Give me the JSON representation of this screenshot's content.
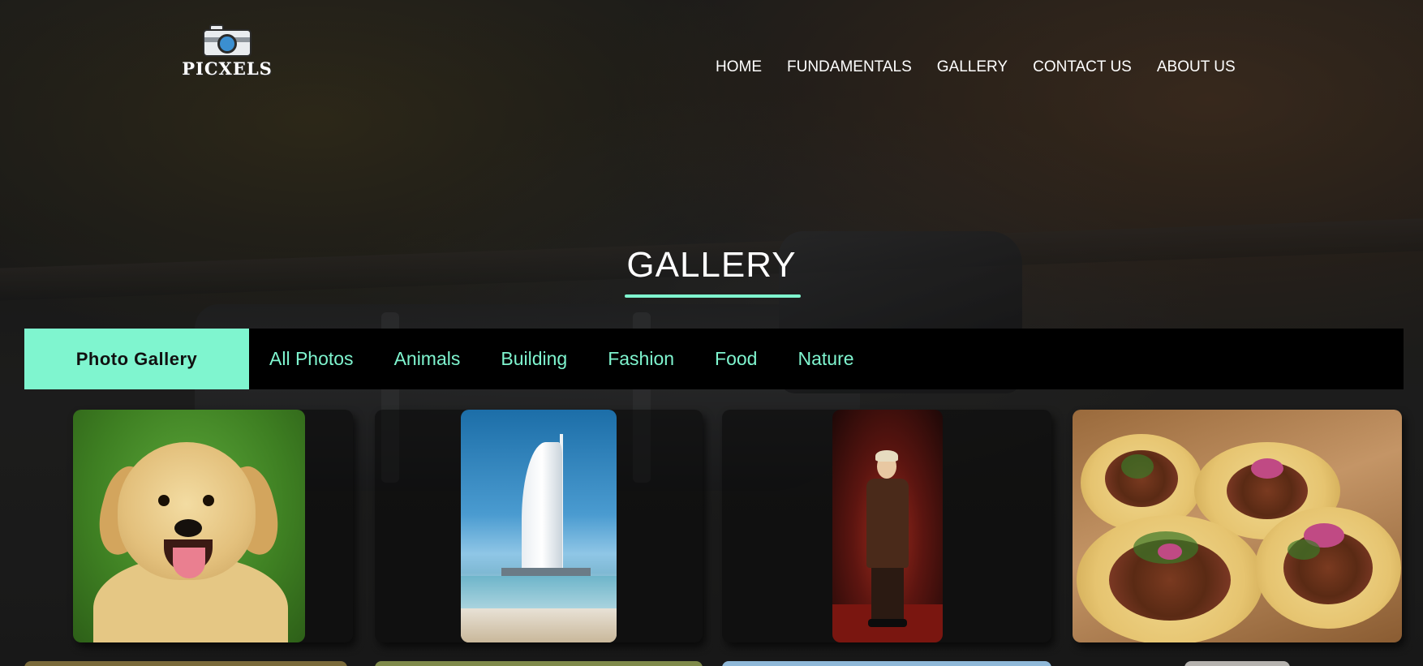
{
  "site": {
    "logo_text": "PICXELS"
  },
  "nav": {
    "items": [
      {
        "label": "HOME"
      },
      {
        "label": "FUNDAMENTALS"
      },
      {
        "label": "GALLERY"
      },
      {
        "label": "CONTACT US"
      },
      {
        "label": "ABOUT US"
      }
    ]
  },
  "hero": {
    "title": "GALLERY"
  },
  "filter": {
    "active_label": "Photo Gallery",
    "categories": [
      {
        "label": "All Photos"
      },
      {
        "label": "Animals"
      },
      {
        "label": "Building"
      },
      {
        "label": "Fashion"
      },
      {
        "label": "Food"
      },
      {
        "label": "Nature"
      }
    ]
  },
  "gallery": {
    "photos": [
      {
        "subject": "golden retriever puppy",
        "category": "Animals"
      },
      {
        "subject": "Burj Al Arab tower by the sea",
        "category": "Building"
      },
      {
        "subject": "person standing in red-lit studio",
        "category": "Fashion"
      },
      {
        "subject": "tacos on wooden board",
        "category": "Food"
      }
    ]
  },
  "colors": {
    "accent": "#7ff5cf",
    "filter_bar_bg": "#000000",
    "nav_text": "#ffffff"
  }
}
